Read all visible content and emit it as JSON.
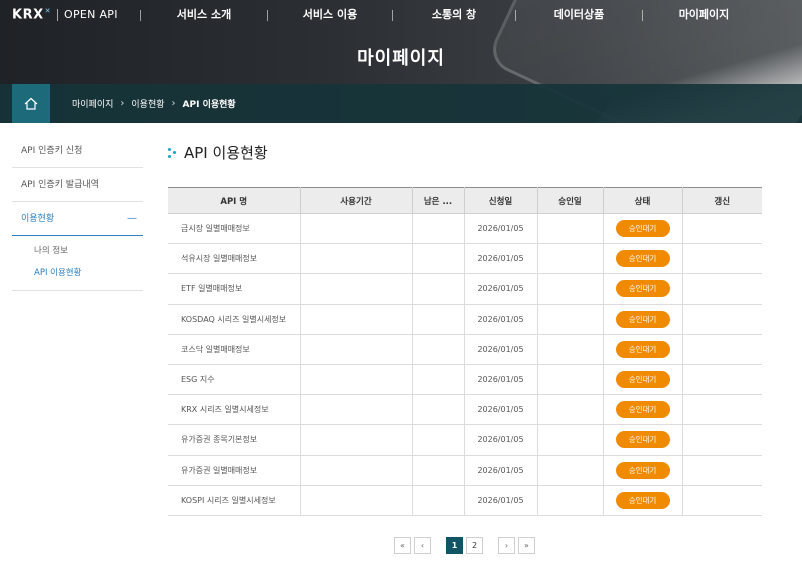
{
  "header": {
    "logo_brand": "KRX",
    "logo_mark": "✕",
    "logo_product": "OPEN API",
    "nav": [
      {
        "label": "서비스 소개",
        "width": 126
      },
      {
        "label": "서비스 이용",
        "width": 124
      },
      {
        "label": "소통의 창",
        "width": 122
      },
      {
        "label": "데이터상품",
        "width": 126
      },
      {
        "label": "마이페이지",
        "width": 122
      }
    ],
    "page_title": "마이페이지"
  },
  "breadcrumb": {
    "items": [
      "마이페이지",
      "이용현황",
      "API 이용현황"
    ]
  },
  "sidebar": {
    "items": [
      "API 인증키 신청",
      "API 인증키 발급내역"
    ],
    "active_group": "이용현황",
    "active_group_marker": "—",
    "sub_items": [
      "나의 정보",
      "API 이용현황"
    ],
    "active_sub_index": 1
  },
  "content": {
    "title": "API 이용현황",
    "columns": [
      "API 명",
      "사용기간",
      "남은 ...",
      "신청일",
      "승인일",
      "상태",
      "갱신"
    ],
    "rows": [
      {
        "name": "금시장 일별매매정보",
        "period": "",
        "remain": "",
        "applied": "2026/01/05",
        "approved": "",
        "status": "승인대기",
        "renew": ""
      },
      {
        "name": "석유시장 일별매매정보",
        "period": "",
        "remain": "",
        "applied": "2026/01/05",
        "approved": "",
        "status": "승인대기",
        "renew": ""
      },
      {
        "name": "ETF 일별매매정보",
        "period": "",
        "remain": "",
        "applied": "2026/01/05",
        "approved": "",
        "status": "승인대기",
        "renew": ""
      },
      {
        "name": "KOSDAQ 시리즈 일별시세정보",
        "period": "",
        "remain": "",
        "applied": "2026/01/05",
        "approved": "",
        "status": "승인대기",
        "renew": ""
      },
      {
        "name": "코스닥 일별매매정보",
        "period": "",
        "remain": "",
        "applied": "2026/01/05",
        "approved": "",
        "status": "승인대기",
        "renew": ""
      },
      {
        "name": "ESG 지수",
        "period": "",
        "remain": "",
        "applied": "2026/01/05",
        "approved": "",
        "status": "승인대기",
        "renew": ""
      },
      {
        "name": "KRX 시리즈 일별시세정보",
        "period": "",
        "remain": "",
        "applied": "2026/01/05",
        "approved": "",
        "status": "승인대기",
        "renew": ""
      },
      {
        "name": "유가증권 종목기본정보",
        "period": "",
        "remain": "",
        "applied": "2026/01/05",
        "approved": "",
        "status": "승인대기",
        "renew": ""
      },
      {
        "name": "유가증권 일별매매정보",
        "period": "",
        "remain": "",
        "applied": "2026/01/05",
        "approved": "",
        "status": "승인대기",
        "renew": ""
      },
      {
        "name": "KOSPI 시리즈 일별시세정보",
        "period": "",
        "remain": "",
        "applied": "2026/01/05",
        "approved": "",
        "status": "승인대기",
        "renew": ""
      }
    ]
  },
  "pagination": {
    "first": "«",
    "prev": "‹",
    "pages": [
      "1",
      "2"
    ],
    "current": "1",
    "next": "›",
    "last": "»"
  },
  "colors": {
    "accent_blue": "#2a7fc1",
    "status_orange": "#f08a00",
    "breadcrumb_bar": "#16343a",
    "active_page": "#0f5566"
  }
}
